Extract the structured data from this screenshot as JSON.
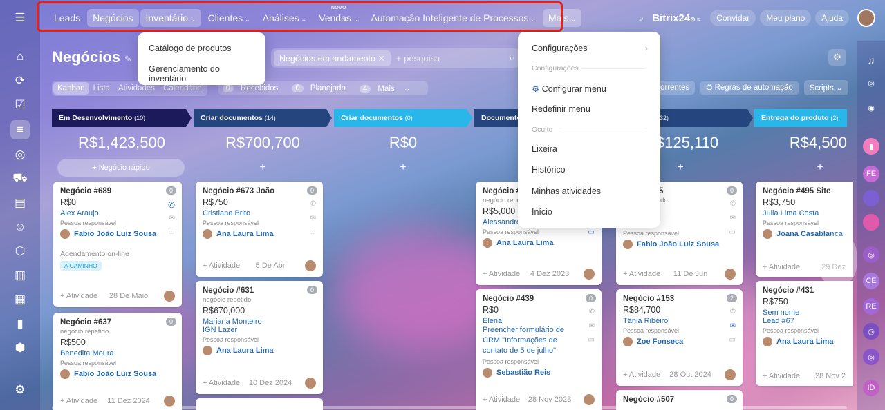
{
  "nav": {
    "items": [
      {
        "label": "Leads",
        "caret": false
      },
      {
        "label": "Negócios",
        "caret": false,
        "selected": true
      },
      {
        "label": "Inventário",
        "caret": true,
        "selected": true
      },
      {
        "label": "Clientes",
        "caret": true
      },
      {
        "label": "Análises",
        "caret": true
      },
      {
        "label": "Vendas",
        "caret": true,
        "badge": "NOVO"
      },
      {
        "label": "Automação Inteligente de Processos",
        "caret": true
      },
      {
        "label": "Mais",
        "caret": true,
        "selected": true
      }
    ],
    "caret": "⌄",
    "novo": "NOVO"
  },
  "topright": {
    "brand": "Bitrix",
    "brand_num": "24",
    "convidar": "Convidar",
    "plan": "Meu plano",
    "help": "Ajuda"
  },
  "page": {
    "title": "Negócios",
    "search_chip": "Negócios em andamento",
    "search_placeholder": "+ pesquisa"
  },
  "views": [
    "Kanban",
    "Lista",
    "Atividades",
    "Calendário"
  ],
  "stages": [
    {
      "count": "0",
      "label": "Recebidos"
    },
    {
      "count": "0",
      "label": "Planejado"
    },
    {
      "count": "4",
      "label": "Mais"
    }
  ],
  "tools": {
    "rec": "orrentes",
    "rules": "Regras de automação",
    "scripts": "Scripts"
  },
  "inventory_menu": [
    "Catálogo de produtos",
    "Gerenciamento do inventário"
  ],
  "more_menu": {
    "configuracoes": "Configurações",
    "section_config": "Configurações",
    "configurar_menu": "Configurar menu",
    "redefinir": "Redefinir menu",
    "section_oculto": "Oculto",
    "lixeira": "Lixeira",
    "historico": "Histórico",
    "minhas": "Minhas atividades",
    "inicio": "Início"
  },
  "columns": [
    {
      "title": "Em Desenvolvimento",
      "count": "(10)",
      "sum": "R$1,423,500",
      "quick": "+ Negócio rápido",
      "color": "#1d1a5c"
    },
    {
      "title": "Criar documentos",
      "count": "(14)",
      "sum": "R$700,700",
      "quick": "+",
      "color": "#24457d"
    },
    {
      "title": "Criar documentos",
      "count": "(0)",
      "sum": "R$0",
      "quick": "+",
      "color": "#29b6e8"
    },
    {
      "title": "Documento",
      "count": "",
      "sum": "",
      "quick": "",
      "color": "#24457d"
    },
    {
      "title": "",
      "count": "32)",
      "sum": "$125,110",
      "quick": "+",
      "color": "#24457d"
    },
    {
      "title": "Entrega do produto",
      "count": "(2)",
      "sum": "R$4,500",
      "quick": "+",
      "color": "#29b6e8"
    }
  ],
  "common": {
    "resp": "Pessoa responsável",
    "activity": "+ Atividade",
    "repeated": "negócio repetido"
  },
  "cards": {
    "c689": {
      "title": "Negócio #689",
      "badge": "0",
      "amount": "R$0",
      "contact": "Alex Araujo",
      "person": "Fabio João Luiz Sousa",
      "sched": "Agendamento on-line",
      "tag": "A CAMINHO",
      "date": "28 De Maio"
    },
    "c637": {
      "title": "Negócio #637",
      "badge": "0",
      "amount": "R$500",
      "contact": "Benedita Moura",
      "person": "Fabio João Luiz Sousa",
      "date": "11 Dez 2024"
    },
    "c673": {
      "title": "Negócio #673 João",
      "badge": "0",
      "amount": "R$750",
      "contact": "Cristiano Brito",
      "person": "Ana Laura Lima",
      "date": "5 De Abr"
    },
    "c631": {
      "title": "Negócio #631",
      "badge": "0",
      "amount": "R$670,000",
      "contact": "Mariana Monteiro",
      "contact2": "IGN Lazer",
      "person": "Ana Laura Lima",
      "date": "10 Dez 2024"
    },
    "c4x": {
      "title": "Negócio #",
      "badge": "0",
      "sub": "negócio repe",
      "amount": "R$5,000",
      "contact": "Alessandro Souza",
      "person": "Ana Laura Lima",
      "date": "4 Dez 2023"
    },
    "c439": {
      "title": "Negócio #439",
      "badge": "0",
      "amount": "R$0",
      "contact": "Elena",
      "desc": "Preencher formulário de CRM \"Informações de contato de 5 de julho\"",
      "person": "Sebastião Reis",
      "date": "28 Nov 2023"
    },
    "c5x": {
      "title": "5",
      "badge": "0",
      "sub": "ido",
      "contact": "DNW",
      "person": "Fabio João Luiz Sousa",
      "date": "11 De Jun"
    },
    "c153": {
      "title": "Negócio #153",
      "badge": "2",
      "amount": "R$84,700",
      "contact": "Tânia Ribeiro",
      "person": "Zoe Fonseca",
      "date": "28 Out 2024"
    },
    "c507": {
      "title": "Negócio #507",
      "badge": "0"
    },
    "c495": {
      "title": "Negócio #495 Site",
      "amount": "R$3,750",
      "contact": "Julia Lima Costa",
      "person": "Joana Casablanca",
      "date": "29 Dez"
    },
    "c431": {
      "title": "Negócio #431",
      "amount": "R$750",
      "contact": "Sem nome",
      "contact2": "Lead #67",
      "person": "Ana Laura Lima",
      "date": "28 Nov 2"
    }
  },
  "right_rail": [
    "FE",
    "CE",
    "RE",
    "ID"
  ]
}
